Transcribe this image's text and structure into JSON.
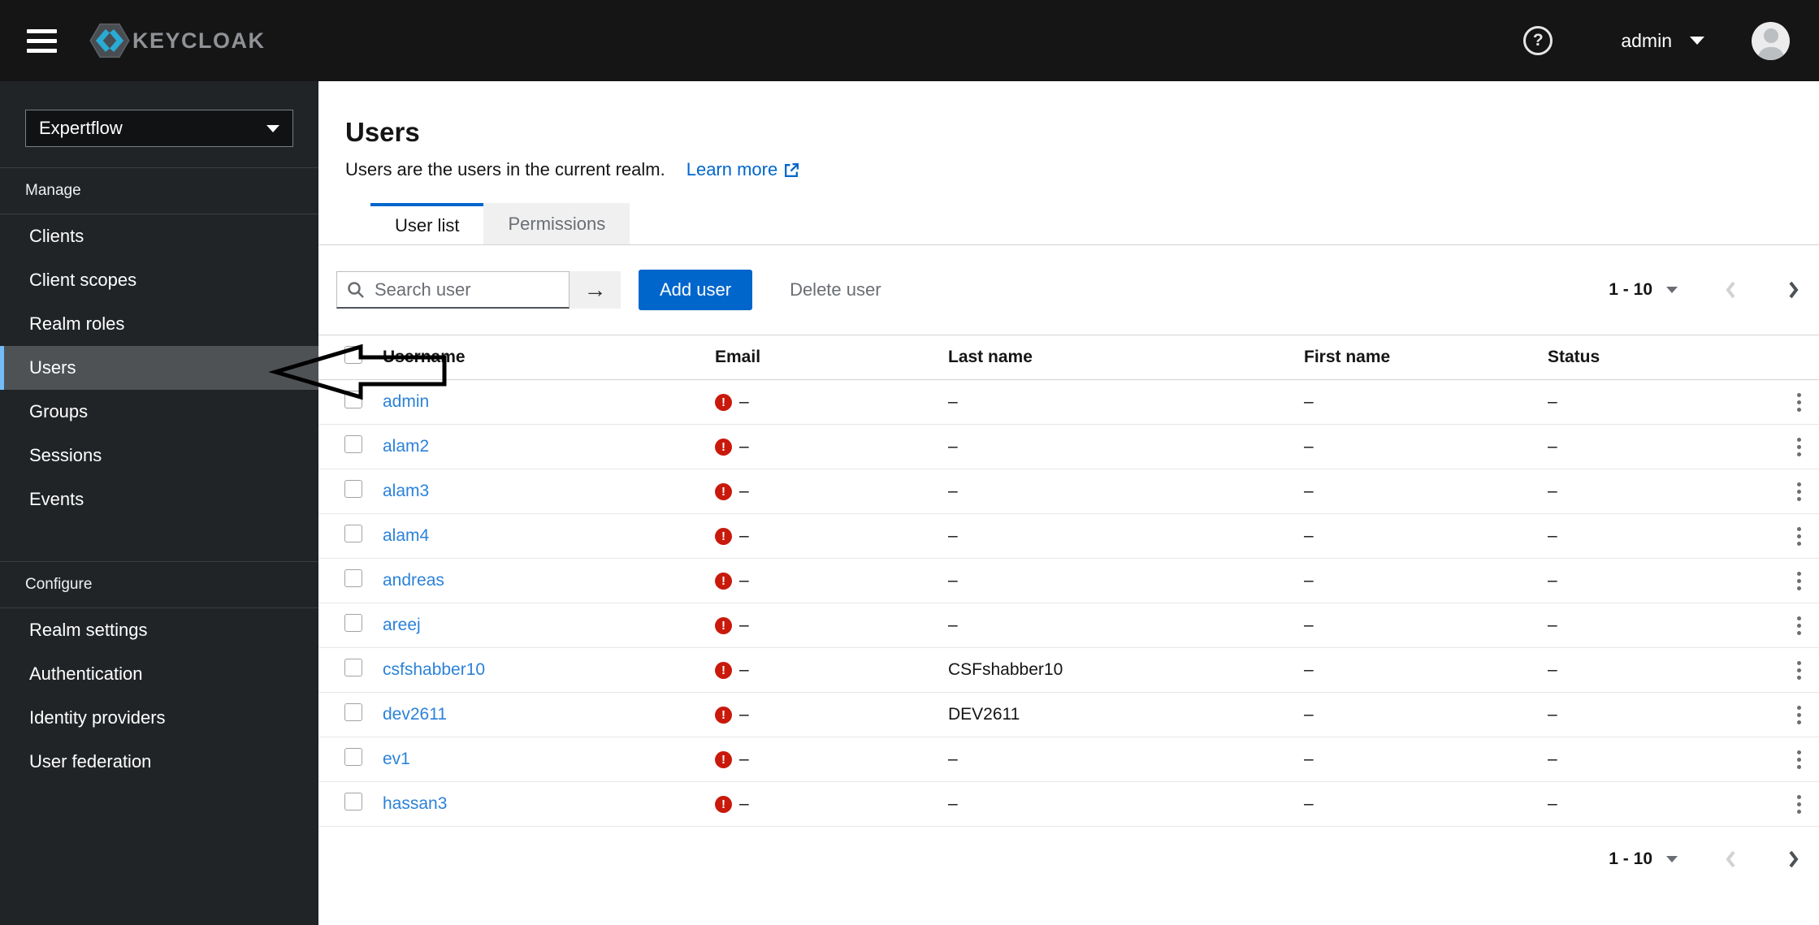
{
  "topbar": {
    "brand": "KEYCLOAK",
    "user": "admin"
  },
  "icons": {
    "help": "?",
    "search_submit": "→",
    "warning": "!"
  },
  "sidebar": {
    "realm": "Expertflow",
    "sections": [
      {
        "label": "Manage",
        "items": [
          "Clients",
          "Client scopes",
          "Realm roles",
          "Users",
          "Groups",
          "Sessions",
          "Events"
        ],
        "selected": "Users"
      },
      {
        "label": "Configure",
        "items": [
          "Realm settings",
          "Authentication",
          "Identity providers",
          "User federation"
        ]
      }
    ]
  },
  "page": {
    "title": "Users",
    "description": "Users are the users in the current realm.",
    "learn_more": "Learn more",
    "tabs": [
      {
        "label": "User list",
        "active": true
      },
      {
        "label": "Permissions",
        "active": false
      }
    ],
    "toolbar": {
      "search_placeholder": "Search user",
      "add_user_label": "Add user",
      "delete_user_label": "Delete user"
    },
    "pagination": {
      "range": "1 - 10"
    }
  },
  "table": {
    "columns": [
      "Username",
      "Email",
      "Last name",
      "First name",
      "Status"
    ],
    "empty_value": "–",
    "rows": [
      {
        "username": "admin",
        "email": "–",
        "last_name": "–",
        "first_name": "–",
        "status": "–"
      },
      {
        "username": "alam2",
        "email": "–",
        "last_name": "–",
        "first_name": "–",
        "status": "–"
      },
      {
        "username": "alam3",
        "email": "–",
        "last_name": "–",
        "first_name": "–",
        "status": "–"
      },
      {
        "username": "alam4",
        "email": "–",
        "last_name": "–",
        "first_name": "–",
        "status": "–"
      },
      {
        "username": "andreas",
        "email": "–",
        "last_name": "–",
        "first_name": "–",
        "status": "–"
      },
      {
        "username": "areej",
        "email": "–",
        "last_name": "–",
        "first_name": "–",
        "status": "–"
      },
      {
        "username": "csfshabber10",
        "email": "–",
        "last_name": "CSFshabber10",
        "first_name": "–",
        "status": "–"
      },
      {
        "username": "dev2611",
        "email": "–",
        "last_name": "DEV2611",
        "first_name": "–",
        "status": "–"
      },
      {
        "username": "ev1",
        "email": "–",
        "last_name": "–",
        "first_name": "–",
        "status": "–"
      },
      {
        "username": "hassan3",
        "email": "–",
        "last_name": "–",
        "first_name": "–",
        "status": "–"
      }
    ]
  },
  "colors": {
    "topbar_bg": "#151515",
    "sidebar_bg": "#212427",
    "nav_selected_bg": "#4f5255",
    "nav_accent": "#73bcf7",
    "primary": "#0066cc",
    "link": "#0066cc",
    "username_link": "#2b82d9",
    "danger": "#c9190b",
    "tab_inactive_bg": "#f0f0f0",
    "muted_text": "#6a6e73",
    "border": "#d2d2d2",
    "logo_cyan": "#29abd4"
  }
}
